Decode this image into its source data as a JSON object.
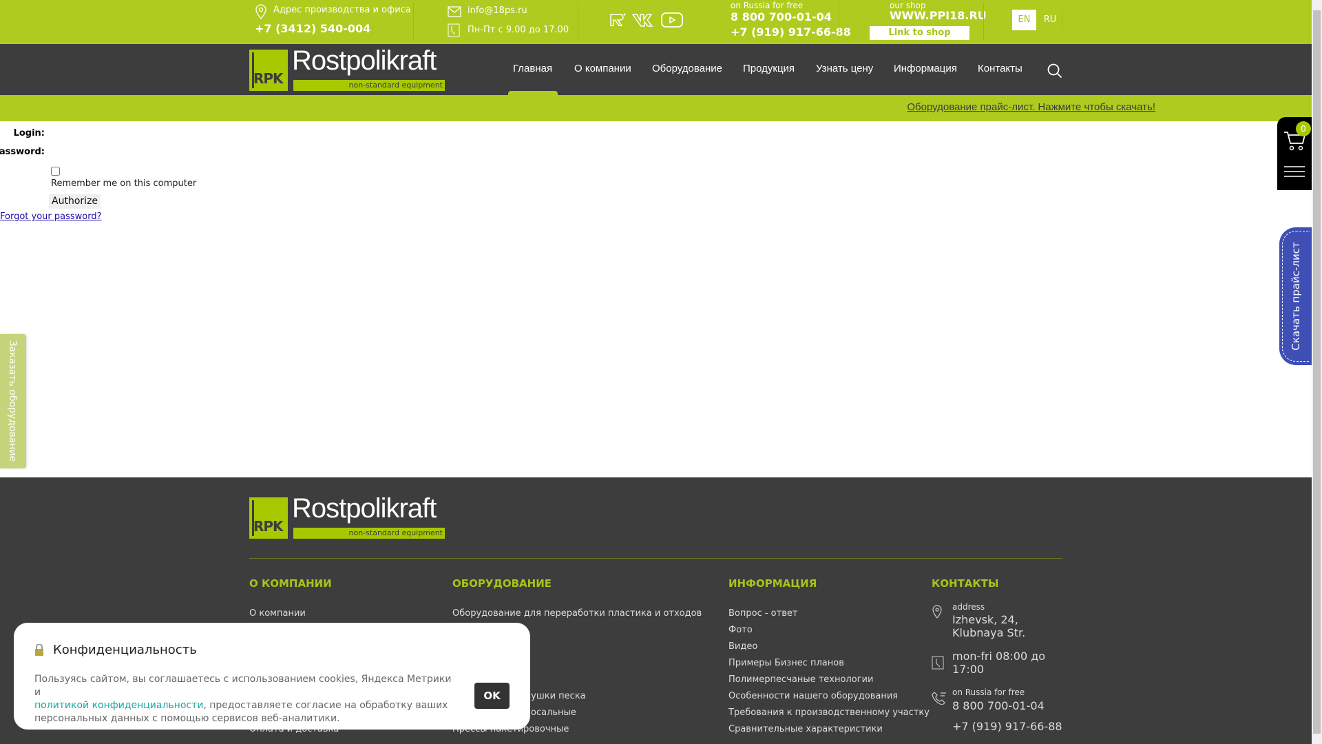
{
  "topbar": {
    "address_label": "Адрес производства и офиса",
    "office_phone": "+7 (3412) 540-004",
    "email": "info@18ps.ru",
    "hours": "Пн-Пт с 9.00 до 17.00",
    "free_label": "on Russia for free",
    "free_phone": "8 800 700-01-04",
    "mobile_phone": "+7 (919) 917-66-88",
    "shop_label": "our shop",
    "shop_url": "WWW.PPI18.RU",
    "shop_button": "Link to shop",
    "lang_en": "EN",
    "lang_ru": "RU"
  },
  "logo": {
    "mark": "RPK",
    "name": "Rostpolikraft",
    "tagline": "non-standard equipment"
  },
  "nav": [
    "Главная",
    "О компании",
    "Оборудование",
    "Продукция",
    "Узнать цену",
    "Информация",
    "Контакты"
  ],
  "banner": {
    "link": "Оборудование прайс-лист. Нажмите чтобы скачать!"
  },
  "form": {
    "login_label": "Login:",
    "password_label": "Password:",
    "remember": "Remember me on this computer",
    "submit": "Authorize",
    "forgot": "Forgot your password?"
  },
  "cart": {
    "count": "0"
  },
  "side": {
    "price_tab": "Скачать прайс-лист",
    "order_tab": "Заказать оборудование"
  },
  "footer": {
    "col1": {
      "title": "О КОМПАНИИ",
      "items": [
        "О компании",
        "Оплата и доставка"
      ]
    },
    "col2": {
      "title": "ОБОРУДОВАНИЕ",
      "items": [
        "Оборудование для переработки пластика и отходов",
        "сушки песка",
        "осальные",
        "Прессы пакетировочные"
      ]
    },
    "col3": {
      "title": "ИНФОРМАЦИЯ",
      "items": [
        "Вопрос - ответ",
        "Фото",
        "Видео",
        "Примеры Бизнес планов",
        "Полимерпесчаные технологии",
        "Особенности нашего оборудования",
        "Требования к производственному участку",
        "Сравнительные характеристики"
      ]
    },
    "col4": {
      "title": "КОНТАКТЫ",
      "address_label": "address",
      "address_1": "Izhevsk, 24,",
      "address_2": "Klubnaya Str.",
      "hours_1": "mon-fri 08:00 до",
      "hours_2": "17:00",
      "free_label": "on Russia for free",
      "free_phone": "8 800 700-01-04",
      "mobile": "+7 (919) 917-66-88"
    }
  },
  "cookie": {
    "title": "Конфиденциальность",
    "text1": "Пользуясь сайтом, вы соглашаетесь с использованием cookies, Яндекса Метрики и",
    "link": "политикой конфиденциальности",
    "text2": ", предоставляете согласие на обработку ваших",
    "text3": "персональных данных с помощью сервисов веб-аналитики.",
    "ok": "OK"
  },
  "colors": {
    "green": "#b0cb1f",
    "dark": "#3d3d3d",
    "blue": "#3f4fb5"
  }
}
